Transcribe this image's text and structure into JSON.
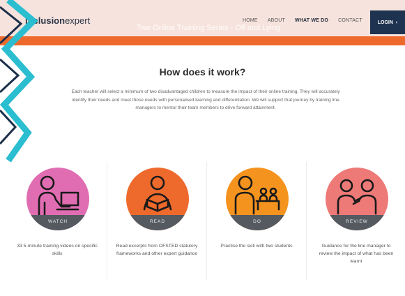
{
  "header": {
    "logo_bold": "inclusion",
    "logo_light": "expert",
    "banner_text": "Two Online Training Series - Off and Lying",
    "nav": [
      "HOME",
      "ABOUT",
      "WHAT WE DO",
      "CONTACT"
    ],
    "login": "LOGIN"
  },
  "main": {
    "title": "How does it work?",
    "intro": "Each teacher will select a minimum of two disadvantaged children to measure the impact of their online training. They will accurately identify their needs and meet those needs with personalised learning and differentiation. We will support that journey by training line managers to mentor their team members to drive forward attainment."
  },
  "steps": [
    {
      "label": "WATCH",
      "desc": "33 5-minute training videos on specific skills",
      "color": "#e06db2",
      "icon": "person-at-computer-icon"
    },
    {
      "label": "READ",
      "desc": "Read excerpts from OFSTED statutory frameworks and other expert guidance",
      "color": "#ee6a2c",
      "icon": "person-reading-icon"
    },
    {
      "label": "DO",
      "desc": "Practise the skill with two students",
      "color": "#f5931f",
      "icon": "teacher-with-students-icon"
    },
    {
      "label": "REVIEW",
      "desc": "Guidance for the line manager to review the impact of what has been learnt",
      "color": "#ee7a78",
      "icon": "two-people-talking-icon"
    }
  ],
  "colors": {
    "accent_orange": "#ee6a2c",
    "header_bg": "#f7e3dd",
    "login_bg": "#1e3350",
    "zigzag": "#2bbdd0"
  }
}
